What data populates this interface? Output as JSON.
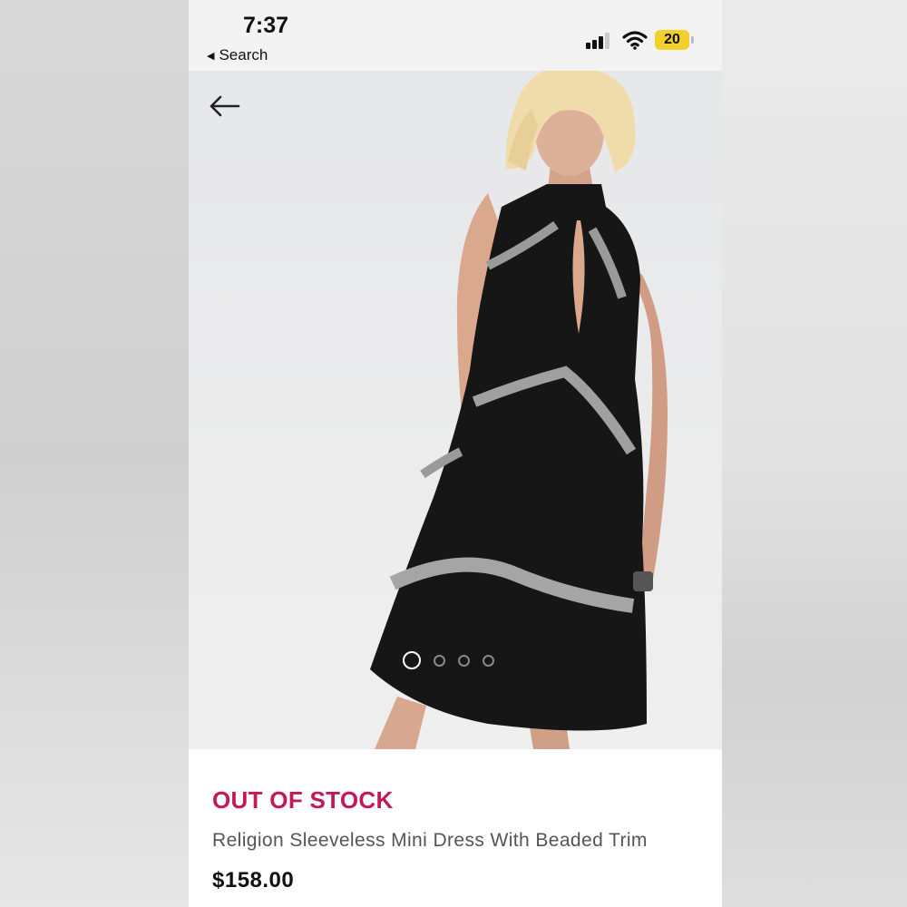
{
  "status_bar": {
    "time": "7:37",
    "back_label": "Search",
    "battery_level": "20",
    "battery_color": "#f2cf2a"
  },
  "product": {
    "stock_status": "OUT OF STOCK",
    "title": "Religion Sleeveless Mini Dress With Beaded Trim",
    "price": "$158.00",
    "stock_status_color": "#c4185a"
  },
  "gallery": {
    "image_count": 4,
    "active_index": 0
  },
  "icons": {
    "back": "arrow-left-icon",
    "signal": "cellular-signal-icon",
    "wifi": "wifi-icon",
    "battery": "battery-icon"
  }
}
